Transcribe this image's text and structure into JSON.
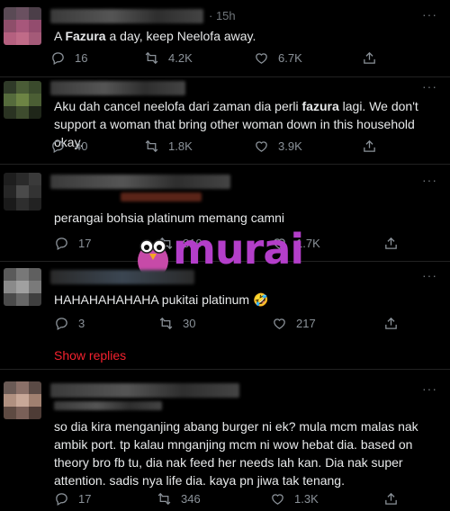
{
  "tweets": [
    {
      "time": "· 15h",
      "text_parts": [
        "A ",
        "Fazura",
        " a day, keep Neelofa away."
      ],
      "replies": "16",
      "retweets": "4.2K",
      "likes": "6.7K"
    },
    {
      "text_parts": [
        "Aku dah cancel neelofa dari zaman dia perli ",
        "fazura",
        " lagi. We don't support a woman that bring other woman down in this household okay."
      ],
      "replies": "40",
      "retweets": "1.8K",
      "likes": "3.9K"
    },
    {
      "text": "perangai bohsia platinum memang camni",
      "replies": "17",
      "retweets": "819",
      "likes": "1.7K"
    },
    {
      "text": "HAHAHAHAHAHA pukitai platinum 🤣",
      "replies": "3",
      "retweets": "30",
      "likes": "217",
      "show_replies": "Show replies"
    },
    {
      "text": "so dia kira menganjing abang burger ni ek? mula mcm malas nak ambik port. tp kalau mnganjing mcm ni wow hebat dia. based on theory bro fb tu, dia nak feed her needs lah kan. Dia nak super attention. sadis nya life dia. kaya pn jiwa tak tenang.",
      "replies": "17",
      "retweets": "346",
      "likes": "1.3K"
    }
  ],
  "watermark": {
    "text": "murai",
    "color": "#b33ec9"
  },
  "icons": [
    "reply-icon",
    "retweet-icon",
    "like-icon",
    "share-icon",
    "more-icon"
  ],
  "colors": {
    "background": "#000000",
    "text": "#e7e9ea",
    "muted": "#71767b",
    "link_red": "#f4212e"
  }
}
